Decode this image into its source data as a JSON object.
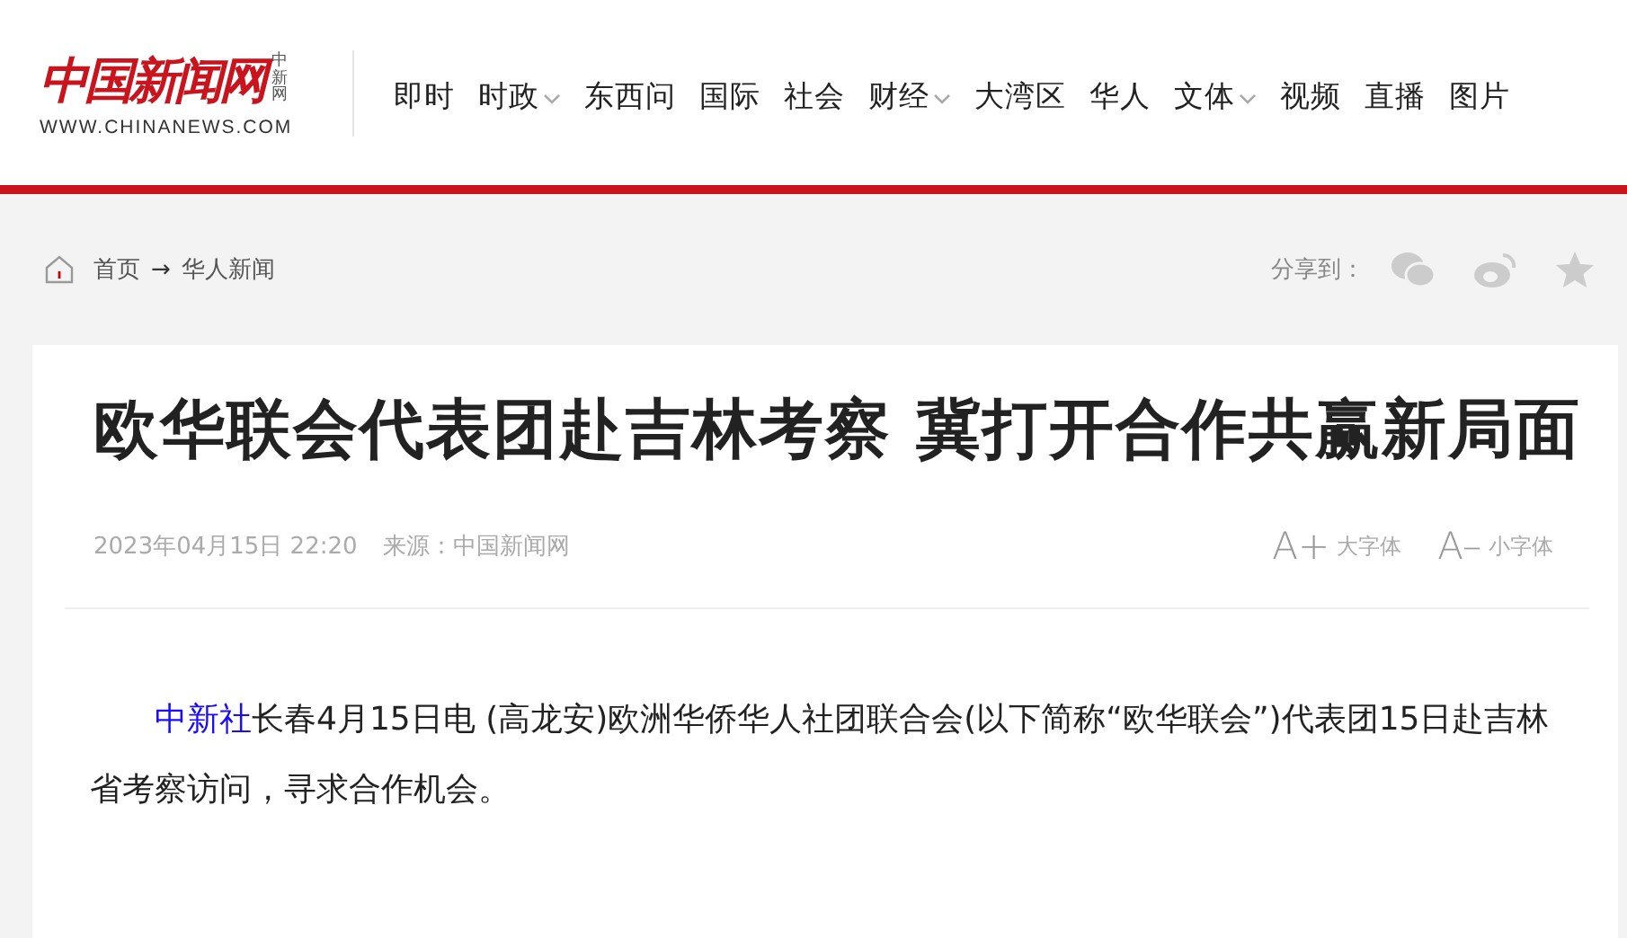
{
  "logo": {
    "name": "中国新闻网",
    "small": "中新网",
    "url": "WWW.CHINANEWS.COM"
  },
  "nav": [
    {
      "label": "即时",
      "dropdown": false
    },
    {
      "label": "时政",
      "dropdown": true
    },
    {
      "label": "东西问",
      "dropdown": false
    },
    {
      "label": "国际",
      "dropdown": false
    },
    {
      "label": "社会",
      "dropdown": false
    },
    {
      "label": "财经",
      "dropdown": true
    },
    {
      "label": "大湾区",
      "dropdown": false
    },
    {
      "label": "华人",
      "dropdown": false
    },
    {
      "label": "文体",
      "dropdown": true
    },
    {
      "label": "视频",
      "dropdown": false
    },
    {
      "label": "直播",
      "dropdown": false
    },
    {
      "label": "图片",
      "dropdown": false
    }
  ],
  "breadcrumb": {
    "items": [
      "首页",
      "华人新闻"
    ],
    "separator": "→"
  },
  "share": {
    "label": "分享到："
  },
  "article": {
    "title": "欧华联会代表团赴吉林考察 冀打开合作共赢新局面",
    "date": "2023年04月15日 22:20",
    "source": "来源：中国新闻网",
    "font_controls": [
      {
        "glyph": "A+",
        "label": "大字体"
      },
      {
        "glyph": "A–",
        "label": "小字体"
      }
    ],
    "lead_link": "中新社",
    "body": "长春4月15日电 (高龙安)欧洲华侨华人社团联合会(以下简称“欧华联会”)代表团15日赴吉林省考察访问，寻求合作机会。"
  }
}
